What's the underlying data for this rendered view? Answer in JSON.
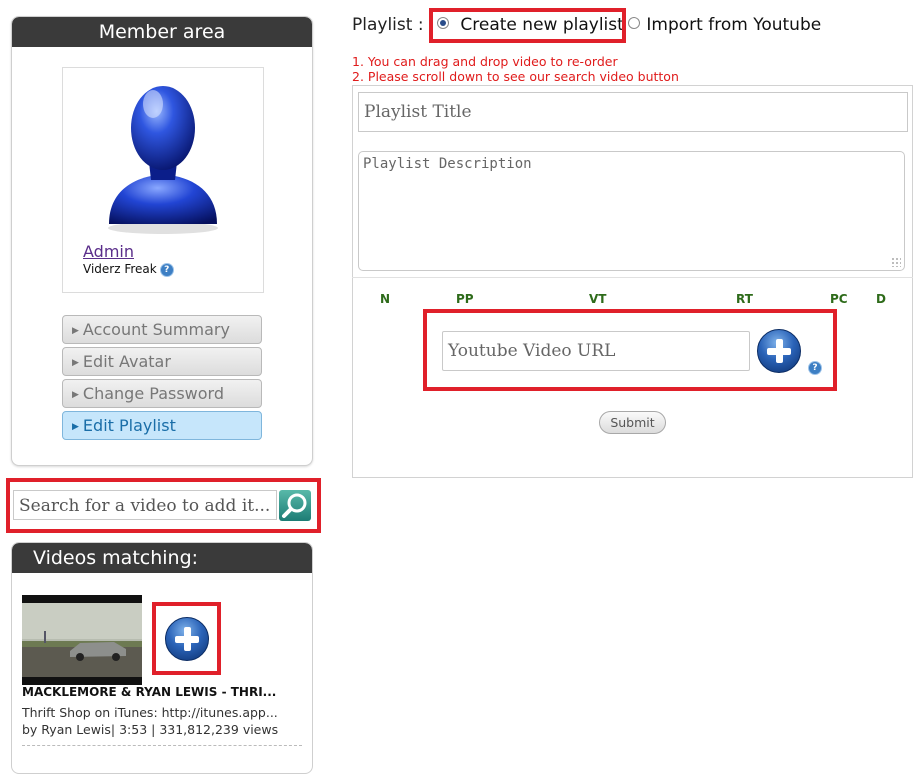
{
  "sidebar": {
    "header": "Member area",
    "user": {
      "name": "Admin",
      "rank": "Viderz Freak"
    },
    "menu": [
      {
        "label": "Account Summary"
      },
      {
        "label": "Edit Avatar"
      },
      {
        "label": "Change Password"
      },
      {
        "label": "Edit Playlist",
        "active": true
      }
    ],
    "search_placeholder": "Search for a video to add it...",
    "videos_header": "Videos matching:",
    "video": {
      "title": "MACKLEMORE & RYAN LEWIS - THRI...",
      "description": "Thrift Shop on iTunes: http://itunes.app...",
      "meta": "by Ryan Lewis| 3:53 | 331,812,239 views"
    }
  },
  "playlist": {
    "label": "Playlist :",
    "option_create": "Create new playlist",
    "option_import": "Import from Youtube",
    "selected": "create",
    "notes": [
      "1. You can drag and drop video to re-order",
      "2. Please scroll down to see our search video button"
    ],
    "title_placeholder": "Playlist Title",
    "description_placeholder": "Playlist Description",
    "columns": [
      "N",
      "PP",
      "VT",
      "RT",
      "PC",
      "D"
    ],
    "url_placeholder": "Youtube Video URL",
    "help": "?",
    "submit_label": "Submit"
  },
  "colors": {
    "highlight": "#e0202a",
    "header_bg": "#3a3a3a",
    "active_menu": "#c6e6fb",
    "note_text": "#e01b1b",
    "column_text": "#2e6b1a"
  },
  "icons": [
    "user-avatar-icon",
    "help-icon",
    "search-icon",
    "add-circle-icon",
    "radio-icon",
    "resize-grip-icon"
  ]
}
